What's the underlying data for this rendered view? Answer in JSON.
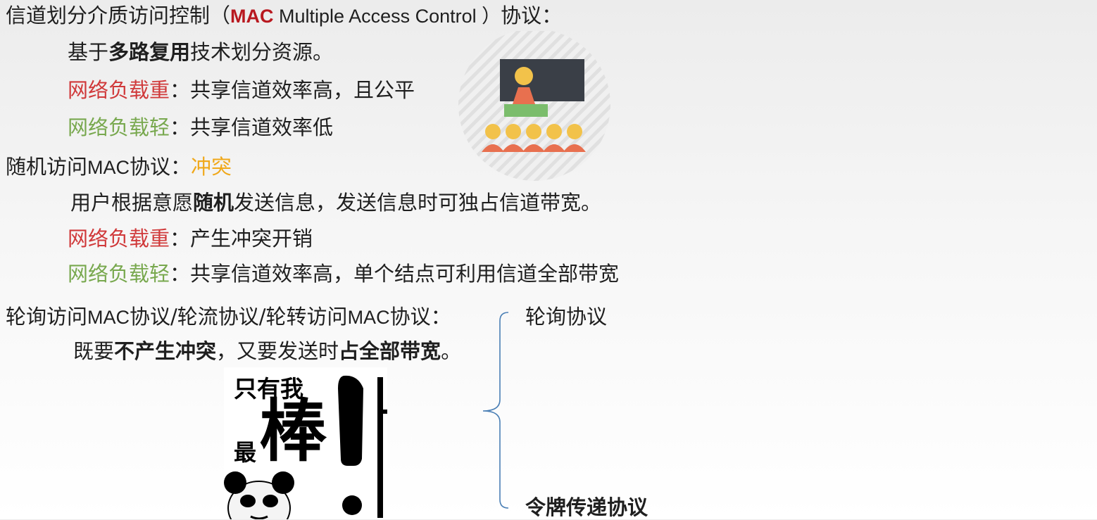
{
  "section1": {
    "title_prefix": "信道划分介质访问控制（",
    "title_mac": "MAC",
    "title_en": " Multiple Access Control ）",
    "title_suffix": "协议：",
    "basis_prefix": "基于",
    "basis_bold": "多路复用",
    "basis_suffix": "技术划分资源。",
    "heavy_label": "网络负载重",
    "heavy_text": "：共享信道效率高，且公平",
    "light_label": "网络负载轻",
    "light_text": "：共享信道效率低"
  },
  "section2": {
    "title_prefix": "随机访问",
    "title_mac": "MAC",
    "title_suffix": "协议：",
    "title_highlight": "冲突",
    "desc_prefix": "用户根据意愿",
    "desc_bold": "随机",
    "desc_suffix": "发送信息，发送信息时可独占信道带宽。",
    "heavy_label": "网络负载重",
    "heavy_text": "：产生冲突开销",
    "light_label": "网络负载轻",
    "light_text": "：共享信道效率高，单个结点可利用信道全部带宽"
  },
  "section3": {
    "title_part1": "轮询访问",
    "title_mac1": "MAC",
    "title_part2": "协议/轮流协议/轮转访问",
    "title_mac2": "MAC",
    "title_part3": "协议：",
    "desc_prefix": "既要",
    "desc_bold1": "不产生冲突",
    "desc_middle": "，又要发送时",
    "desc_bold2": "占全部带宽",
    "desc_suffix": "。",
    "branch1": "轮询协议",
    "branch2": "令牌传递协议"
  },
  "meme": {
    "line1": "只有我",
    "line2": "最",
    "line3": "棒"
  },
  "colors": {
    "red": "#d0393a",
    "green": "#78a84e",
    "orange": "#f0a81a",
    "mac_red": "#b8181f",
    "brace": "#4a7fb5"
  },
  "icons": [
    "classroom-presentation-icon",
    "brace-connector",
    "panda-meme-image"
  ]
}
